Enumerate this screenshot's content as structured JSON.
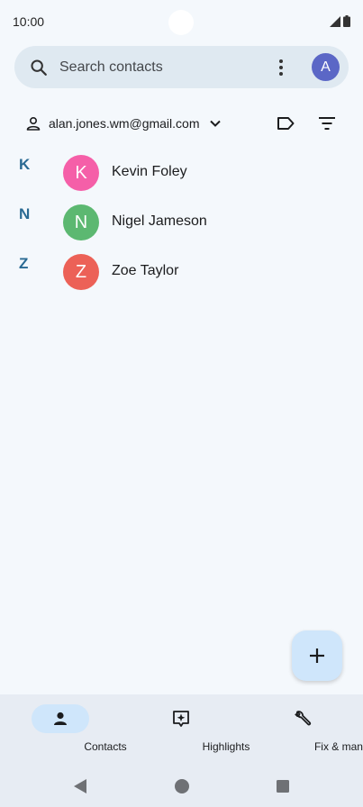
{
  "status_bar": {
    "time": "10:00"
  },
  "search": {
    "placeholder": "Search contacts",
    "account_initial": "A"
  },
  "account": {
    "email": "alan.jones.wm@gmail.com"
  },
  "contacts": [
    {
      "section": "K",
      "initial": "K",
      "name": "Kevin Foley",
      "color": "#f55fa8"
    },
    {
      "section": "N",
      "initial": "N",
      "name": "Nigel Jameson",
      "color": "#5cb871"
    },
    {
      "section": "Z",
      "initial": "Z",
      "name": "Zoe Taylor",
      "color": "#ec6157"
    }
  ],
  "bottom_nav": {
    "items": [
      {
        "label": "Contacts",
        "icon": "person-icon",
        "active": true
      },
      {
        "label": "Highlights",
        "icon": "highlights-icon",
        "active": false
      },
      {
        "label": "Fix & manage",
        "icon": "wrench-icon",
        "active": false
      }
    ]
  },
  "colors": {
    "accent": "#2a6a93",
    "search_bg": "#dfe9f1",
    "fab_bg": "#cfe6fb",
    "account_avatar": "#5b67c6"
  }
}
